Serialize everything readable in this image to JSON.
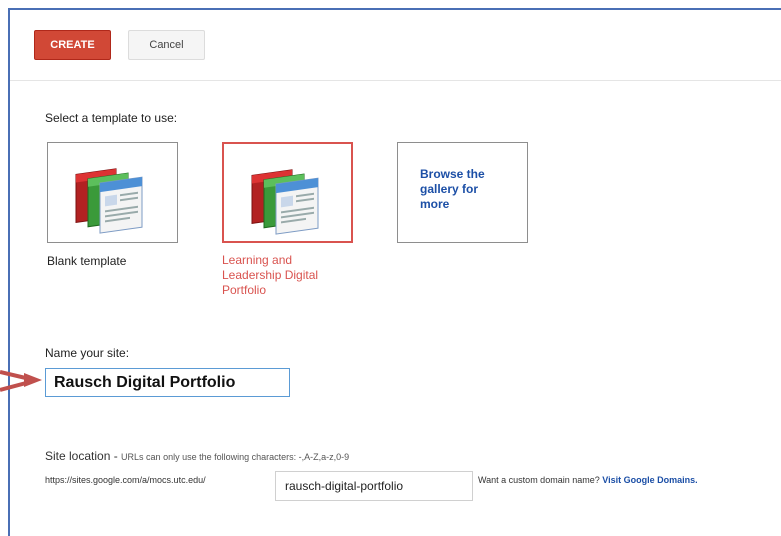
{
  "toolbar": {
    "create_label": "CREATE",
    "cancel_label": "Cancel"
  },
  "templates": {
    "heading": "Select a template to use:",
    "items": [
      {
        "caption": "Blank template",
        "selected": false
      },
      {
        "caption": "Learning and Leadership Digital Portfolio",
        "selected": true
      },
      {
        "caption": "Browse the gallery for more",
        "selected": false
      }
    ]
  },
  "name": {
    "label": "Name your site:",
    "value": "Rausch Digital Portfolio"
  },
  "location": {
    "label": "Site location",
    "separator": " - ",
    "hint": "URLs can only use the following characters: -,A-Z,a-z,0-9",
    "base_url": "https://sites.google.com/a/mocs.utc.edu/",
    "value": "rausch-digital-portfolio",
    "custom_prompt": "Want a custom domain name?",
    "custom_link": "Visit Google Domains."
  },
  "colors": {
    "create_button": "#d14836",
    "selected_border": "#d9534f",
    "link": "#1c4fa6",
    "annotation_arrow": "#c0504d"
  },
  "icons": [
    "site-template-icon",
    "annotation-arrow"
  ]
}
